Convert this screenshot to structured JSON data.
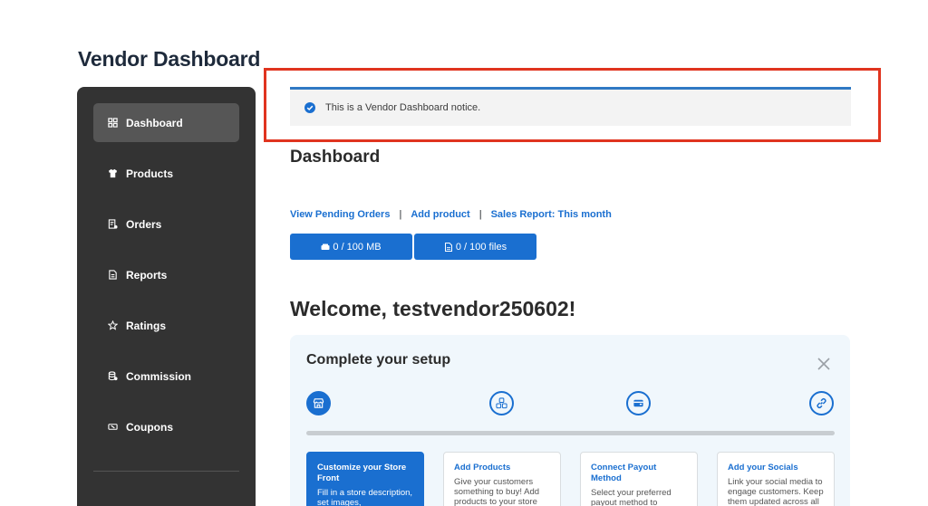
{
  "page_title": "Vendor Dashboard",
  "sidebar": {
    "items": [
      {
        "label": "Dashboard",
        "icon": "dashboard-icon",
        "active": true
      },
      {
        "label": "Products",
        "icon": "shirt-icon",
        "active": false
      },
      {
        "label": "Orders",
        "icon": "orders-icon",
        "active": false
      },
      {
        "label": "Reports",
        "icon": "report-icon",
        "active": false
      },
      {
        "label": "Ratings",
        "icon": "star-icon",
        "active": false
      },
      {
        "label": "Commission",
        "icon": "commission-icon",
        "active": false
      },
      {
        "label": "Coupons",
        "icon": "coupon-icon",
        "active": false
      }
    ]
  },
  "notice": {
    "text": "This is a Vendor Dashboard notice."
  },
  "main": {
    "heading": "Dashboard",
    "links": {
      "pending_orders": "View Pending Orders",
      "add_product": "Add product",
      "sales_report": "Sales Report: This month",
      "separator": "|"
    },
    "quota": {
      "storage": "0 / 100 MB",
      "files": "0 / 100 files"
    },
    "welcome": "Welcome, testvendor250602!"
  },
  "setup": {
    "title": "Complete your setup",
    "steps": [
      {
        "title": "Customize your Store Front",
        "desc": "Fill in a store description, set images,",
        "icon": "store-icon"
      },
      {
        "title": "Add Products",
        "desc": "Give your customers something to buy! Add products to your store",
        "icon": "boxes-icon"
      },
      {
        "title": "Connect Payout Method",
        "desc": "Select your preferred payout method to",
        "icon": "wallet-icon"
      },
      {
        "title": "Add your Socials",
        "desc": "Link your social media to engage customers. Keep them updated across all",
        "icon": "link-icon"
      }
    ]
  },
  "colors": {
    "accent": "#1a6fd0",
    "sidebar_bg": "#333333",
    "highlight": "#e0341f"
  }
}
